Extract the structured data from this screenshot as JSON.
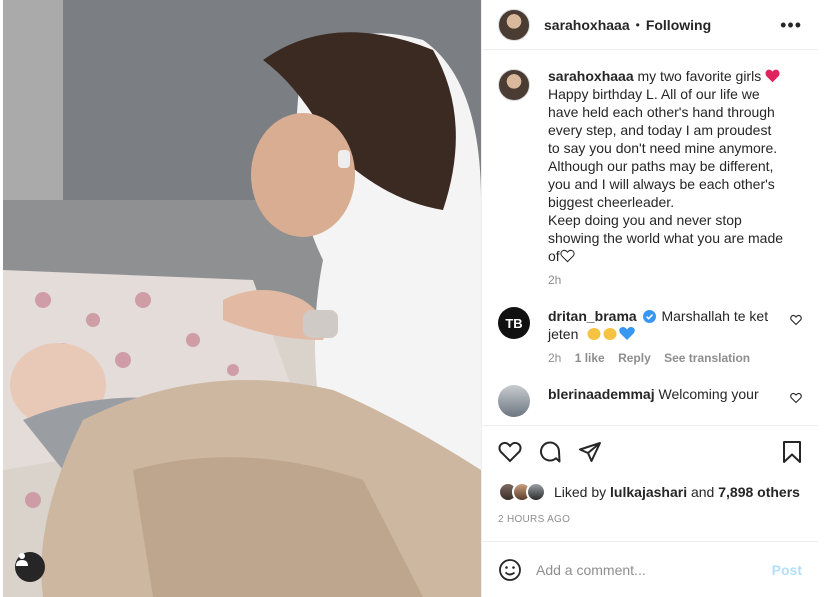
{
  "post": {
    "username": "sarahoxhaaa",
    "separator": "•",
    "following_label": "Following",
    "more_icon": "more-horizontal-icon"
  },
  "caption": {
    "username": "sarahoxhaaa",
    "first": "my two favorite girls",
    "lines": [
      "Happy birthday L. All of our life we",
      "have held each other's hand through",
      "every step, and today I am proudest",
      "to say you don't need mine anymore.",
      "Although our paths may be different,",
      "you and I will always be each other's",
      "biggest cheerleader.",
      "Keep doing you and never stop",
      "showing the world what you are made",
      "of"
    ],
    "time": "2h"
  },
  "comments": [
    {
      "avatar_text": "TB",
      "username": "dritan_brama",
      "text_line1": "Marshallah te ket",
      "text_line2": "jeten",
      "time": "2h",
      "likes": "1 like",
      "reply": "Reply",
      "see_translation": "See translation"
    },
    {
      "username": "blerinaademmaj",
      "text": "Welcoming your"
    }
  ],
  "likes": {
    "prefix": "Liked by",
    "user": "lulkajashari",
    "and": "and",
    "others": "7,898 others"
  },
  "timestamp": "2 HOURS AGO",
  "add_comment": {
    "placeholder": "Add a comment...",
    "post_label": "Post"
  },
  "colors": {
    "accent_disabled": "#b2dffc",
    "heart_red": "#e0245e",
    "verified_blue": "#3897f0"
  }
}
